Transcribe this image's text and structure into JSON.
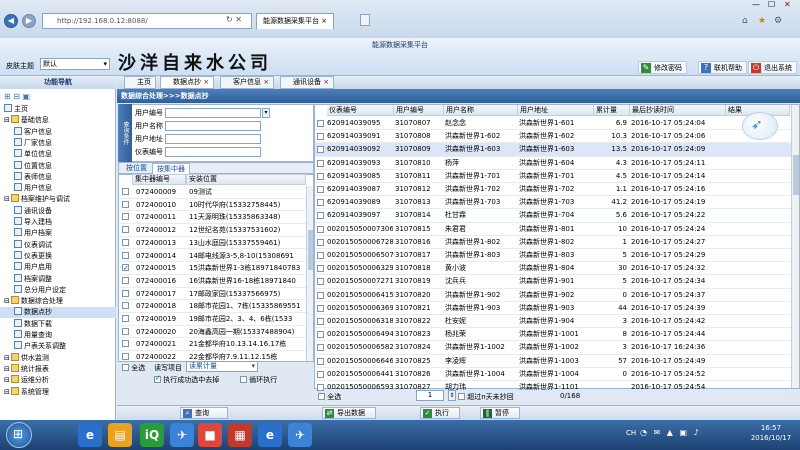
{
  "browser": {
    "address": "http://192.168.0.12:8088/",
    "tab_title": "能源数据采集平台",
    "controls": [
      "—",
      "☐",
      "✕"
    ]
  },
  "banner": {
    "platform_title": "能源数据采集平台",
    "skin_label": "皮肤主题",
    "skin_value": "默认",
    "company": "沙洋自来水公司",
    "buttons": [
      "修改密码",
      "联机帮助",
      "退出系统"
    ]
  },
  "sidebar": {
    "header": "功能导航",
    "items": [
      {
        "label": "主页",
        "depth": 0,
        "folder": false
      },
      {
        "label": "基础信息",
        "depth": 0,
        "folder": true
      },
      {
        "label": "客户信息",
        "depth": 1,
        "folder": false
      },
      {
        "label": "厂家信息",
        "depth": 1,
        "folder": false
      },
      {
        "label": "单位信息",
        "depth": 1,
        "folder": false
      },
      {
        "label": "位置信息",
        "depth": 1,
        "folder": false
      },
      {
        "label": "表师信息",
        "depth": 1,
        "folder": false
      },
      {
        "label": "用户信息",
        "depth": 1,
        "folder": false
      },
      {
        "label": "档案维护与调试",
        "depth": 0,
        "folder": true
      },
      {
        "label": "通讯设备",
        "depth": 1,
        "folder": false
      },
      {
        "label": "导入建档",
        "depth": 1,
        "folder": false
      },
      {
        "label": "用户档案",
        "depth": 1,
        "folder": false
      },
      {
        "label": "仪表调试",
        "depth": 1,
        "folder": false
      },
      {
        "label": "仪表更换",
        "depth": 1,
        "folder": false
      },
      {
        "label": "用户启用",
        "depth": 1,
        "folder": false
      },
      {
        "label": "档案调整",
        "depth": 1,
        "folder": false
      },
      {
        "label": "总分用户设定",
        "depth": 1,
        "folder": false
      },
      {
        "label": "数据综合处理",
        "depth": 0,
        "folder": true
      },
      {
        "label": "数据点抄",
        "depth": 1,
        "folder": false
      },
      {
        "label": "数据下载",
        "depth": 1,
        "folder": false
      },
      {
        "label": "用量查询",
        "depth": 1,
        "folder": false
      },
      {
        "label": "户表关系调整",
        "depth": 1,
        "folder": false
      },
      {
        "label": "供水监测",
        "depth": 0,
        "folder": true
      },
      {
        "label": "统计报表",
        "depth": 0,
        "folder": true
      },
      {
        "label": "运维分析",
        "depth": 0,
        "folder": true
      },
      {
        "label": "系统管理",
        "depth": 0,
        "folder": true
      }
    ]
  },
  "tabs": [
    "主页",
    "数据点抄",
    "客户信息",
    "通讯设备"
  ],
  "section_title": "数据综合处理>>>数据点抄",
  "query": {
    "side_label": "查询条件",
    "fields": [
      "用户编号",
      "用户名称",
      "用户地址",
      "仪表编号"
    ],
    "subtabs": [
      "按位置",
      "按集中器"
    ]
  },
  "left_grid": {
    "headers": [
      "集中器编号",
      "安装位置"
    ],
    "rows": [
      {
        "id": "072400009",
        "loc": "09测试",
        "checked": false
      },
      {
        "id": "072400010",
        "loc": "10时代华府(15332758445)",
        "checked": false
      },
      {
        "id": "072400011",
        "loc": "11天源明珠(15335863348)",
        "checked": false
      },
      {
        "id": "072400012",
        "loc": "12世纪名苑(15337531602)",
        "checked": false
      },
      {
        "id": "072400013",
        "loc": "13山水庭园(15337559461)",
        "checked": false
      },
      {
        "id": "072400014",
        "loc": "14邮电线源3-5,8-10(15308691",
        "checked": false
      },
      {
        "id": "072400015",
        "loc": "15洪森新世界1-3栋18971840783",
        "checked": true
      },
      {
        "id": "072400016",
        "loc": "16洪森新世界16-18栋18971840",
        "checked": false
      },
      {
        "id": "072400017",
        "loc": "17邮政家园(15337566975)",
        "checked": false
      },
      {
        "id": "072400018",
        "loc": "18邮市花园1、7栋(15335869551",
        "checked": false
      },
      {
        "id": "072400019",
        "loc": "19邮市花园2、3、4、6栋(1533",
        "checked": false
      },
      {
        "id": "072400020",
        "loc": "20海鑫高园一期(15337488904)",
        "checked": false
      },
      {
        "id": "072400021",
        "loc": "21金都华府10.13.14.16.17栋",
        "checked": false
      },
      {
        "id": "072400022",
        "loc": "22金都华府7.9.11.12.15栋",
        "checked": false
      }
    ],
    "select_all": "全选",
    "read_label": "读写项目",
    "read_value": "读累计量",
    "opt1": "执行成功选中去掉",
    "opt2": "循环执行",
    "query_button": "查询"
  },
  "right_grid": {
    "headers": [
      "仪表编号",
      "用户编号",
      "用户名称",
      "用户地址",
      "累计量",
      "最后抄读时间",
      "结果"
    ],
    "rows": [
      {
        "meter": "620914039095",
        "uid": "31070807",
        "name": "赵念念",
        "addr": "洪森新世界1-601",
        "total": "6.9",
        "time": "2016-10-17 05:24:04",
        "sel": false
      },
      {
        "meter": "620914039091",
        "uid": "31070808",
        "name": "洪森新世界1-602",
        "addr": "洪森新世界1-602",
        "total": "10.3",
        "time": "2016-10-17 05:24:06",
        "sel": false
      },
      {
        "meter": "620914039092",
        "uid": "31070809",
        "name": "洪森新世界1-603",
        "addr": "洪森新世界1-603",
        "total": "13.5",
        "time": "2016-10-17 05:24:09",
        "sel": true
      },
      {
        "meter": "620914039093",
        "uid": "31070810",
        "name": "杨萍",
        "addr": "洪森新世界1-604",
        "total": "4.3",
        "time": "2016-10-17 05:24:11",
        "sel": false
      },
      {
        "meter": "620914039085",
        "uid": "31070811",
        "name": "洪森新世界1-701",
        "addr": "洪森新世界1-701",
        "total": "4.5",
        "time": "2016-10-17 05:24:14",
        "sel": false
      },
      {
        "meter": "620914039087",
        "uid": "31070812",
        "name": "洪森新世界1-702",
        "addr": "洪森新世界1-702",
        "total": "1.1",
        "time": "2016-10-17 05:24:16",
        "sel": false
      },
      {
        "meter": "620914039089",
        "uid": "31070813",
        "name": "洪森新世界1-703",
        "addr": "洪森新世界1-703",
        "total": "41.2",
        "time": "2016-10-17 05:24:19",
        "sel": false
      },
      {
        "meter": "620914039097",
        "uid": "31070814",
        "name": "杜甘霖",
        "addr": "洪森新世界1-704",
        "total": "5.6",
        "time": "2016-10-17 05:24:22",
        "sel": false
      },
      {
        "meter": "002015050007306",
        "uid": "31070815",
        "name": "朱君君",
        "addr": "洪森新世界1-801",
        "total": "10",
        "time": "2016-10-17 05:24:24",
        "sel": false
      },
      {
        "meter": "002015050006728",
        "uid": "31070816",
        "name": "洪森新世界1-802",
        "addr": "洪森新世界1-802",
        "total": "1",
        "time": "2016-10-17 05:24:27",
        "sel": false
      },
      {
        "meter": "002015050006507",
        "uid": "31070817",
        "name": "洪森新世界1-803",
        "addr": "洪森新世界1-803",
        "total": "5",
        "time": "2016-10-17 05:24:29",
        "sel": false
      },
      {
        "meter": "002015050006329",
        "uid": "31070818",
        "name": "黄小波",
        "addr": "洪森新世界1-804",
        "total": "30",
        "time": "2016-10-17 05:24:32",
        "sel": false
      },
      {
        "meter": "002015050007271",
        "uid": "31070819",
        "name": "沈兵兵",
        "addr": "洪森新世界1-901",
        "total": "5",
        "time": "2016-10-17 05:24:34",
        "sel": false
      },
      {
        "meter": "002015050006415",
        "uid": "31070820",
        "name": "洪森新世界1-902",
        "addr": "洪森新世界1-902",
        "total": "0",
        "time": "2016-10-17 05:24:37",
        "sel": false
      },
      {
        "meter": "002015050006369",
        "uid": "31070821",
        "name": "洪森新世界1-903",
        "addr": "洪森新世界1-903",
        "total": "44",
        "time": "2016-10-17 05:24:39",
        "sel": false
      },
      {
        "meter": "002015050006318",
        "uid": "31070822",
        "name": "杜安妮",
        "addr": "洪森新世界1-904",
        "total": "3",
        "time": "2016-10-17 05:24:42",
        "sel": false
      },
      {
        "meter": "002015050006494",
        "uid": "31070823",
        "name": "杨兆荣",
        "addr": "洪森新世界1-1001",
        "total": "8",
        "time": "2016-10-17 05:24:44",
        "sel": false
      },
      {
        "meter": "002015050006582",
        "uid": "31070824",
        "name": "洪森新世界1-1002",
        "addr": "洪森新世界1-1002",
        "total": "3",
        "time": "2016-10-17 16:24:36",
        "sel": false
      },
      {
        "meter": "002015050006646",
        "uid": "31070825",
        "name": "李凌辉",
        "addr": "洪森新世界1-1003",
        "total": "57",
        "time": "2016-10-17 05:24:49",
        "sel": false
      },
      {
        "meter": "002015050006441",
        "uid": "31070826",
        "name": "洪森新世界1-1004",
        "addr": "洪森新世界1-1004",
        "total": "0",
        "time": "2016-10-17 05:24:52",
        "sel": false
      },
      {
        "meter": "002015050006593",
        "uid": "31070827",
        "name": "胡力玮",
        "addr": "洪森新世界1-1101",
        "total": "",
        "time": "2016-10-17 05:24:54",
        "sel": false
      }
    ],
    "select_all": "全选",
    "page": "1",
    "range_label": "超过n天未抄回",
    "count": "0/168",
    "export": "导出数据",
    "execute": "执行",
    "pause": "暂停"
  },
  "taskbar": {
    "time": "16:57",
    "date": "2016/10/17",
    "lang": "CH"
  }
}
